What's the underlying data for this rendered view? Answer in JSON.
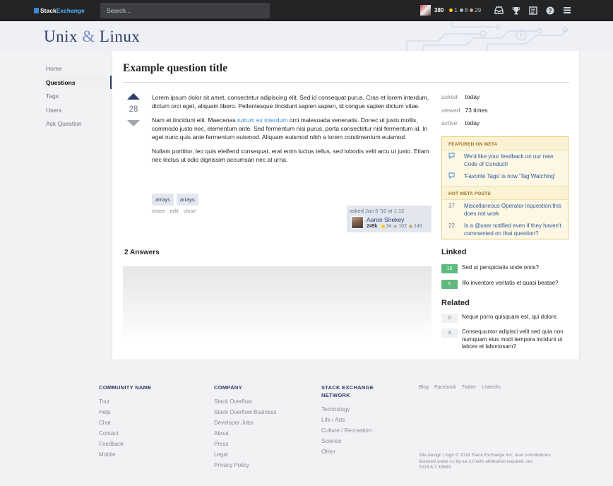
{
  "topbar": {
    "brand_first": "Stack",
    "brand_second": "Exchange",
    "search_placeholder": "Search...",
    "reputation": "380",
    "gold": "1",
    "silver": "8",
    "bronze": "29",
    "icons": [
      "inbox-icon",
      "trophy-icon",
      "review-icon",
      "help-icon",
      "site-switcher-icon"
    ]
  },
  "site": {
    "name_part1": "Unix",
    "amp": "&",
    "name_part2": "Linux"
  },
  "nav": {
    "items": [
      "Home",
      "Questions",
      "Tags",
      "Users",
      "Ask Question"
    ]
  },
  "question": {
    "title": "Example question title",
    "votes": "28",
    "p1": "Lorem ipsum dolor sit amet, consectetur adipiscing elit. Sed id consequat purus. Cras et lorem interdum, dictum orci eget, aliquam libero. Pellentesque tincidunt sapien sapien, id congue sapien dictum vitae.",
    "p2_before": "Nam et tincidunt elit. Maecenas ",
    "p2_link": "rutrum ex interdum",
    "p2_after": " orci malesuada venenatis. Donec ut justo mollis, commodo justo nec, elementum ante. Sed fermentum nisi purus, porta consectetur nisl fermentum id. In eget nunc quis ante fermentum euismod. Aliquam euismod nibh a lorem condimentum euismod.",
    "p3": "Nullam porttitor, leo quis eleifend consequat, erat enim luctus tellus, sed lobortis velit arcu ut justo. Etiam nec lectus ut odio dignissim accumsan nec at urna.",
    "tags": [
      "arrays",
      "arrays"
    ],
    "menu": [
      "share",
      "edit",
      "close"
    ],
    "owner": {
      "asked": "asked Jan 5 '10 at 1:12",
      "name": "Aaron Shekey",
      "rep": "249k",
      "gold": "34",
      "silver": "102",
      "bronze": "143"
    }
  },
  "answers": {
    "header": "2 Answers"
  },
  "meta": {
    "asked_label": "asked",
    "asked_value": "today",
    "viewed_label": "viewed",
    "viewed_value": "73 times",
    "active_label": "active",
    "active_value": "today"
  },
  "blog": {
    "featured_header": "FEATURED ON META",
    "featured": [
      "We'd like your feedback on our new Code of Conduct!",
      "'Favorite Tags' is now 'Tag Watching'"
    ],
    "hot_header": "HOT META POSTS",
    "hot": [
      {
        "num": "37",
        "text": "Miscellaneous Operator inquestion:this does not work"
      },
      {
        "num": "22",
        "text": "Is a @user notified even if they haven't commented on that question?"
      }
    ]
  },
  "linked": {
    "header": "Linked",
    "items": [
      {
        "score": "16",
        "text": "Sed ut perspiciatis unde omis?"
      },
      {
        "score": "5",
        "text": "Illo inventore veritatis et quasi beatae?"
      }
    ]
  },
  "related": {
    "header": "Related",
    "items": [
      {
        "score": "0",
        "text": "Neque porro quisquam est, qui dolore."
      },
      {
        "score": "4",
        "text": "Consequuntor adipisci velit sed quia non numquam eius modi tempora incidunt ut labore et laboriosam?"
      }
    ]
  },
  "footer": {
    "col1": {
      "head": "COMMUNITY NAME",
      "links": [
        "Tour",
        "Help",
        "Chat",
        "Contact",
        "Feedback",
        "Mobile"
      ]
    },
    "col2": {
      "head": "COMPANY",
      "links": [
        "Stack Overflow",
        "Stack Overflow Business",
        "Developer Jobs",
        "About",
        "Press",
        "Legal",
        "Privacy Policy"
      ]
    },
    "col3": {
      "head": "STACK EXCHANGE NETWORK",
      "links": [
        "Technology",
        "Life / Arts",
        "Culture / Recreation",
        "Science",
        "Other"
      ]
    },
    "social": [
      "Blog",
      "Facebook",
      "Twitter",
      "LinkedIn"
    ],
    "legal": "Site design / logo © 2018 Stack Exchange Inc; user contributions licensed under cc by-sa 3.0 with attribution required. rev 2018.6.7.30693"
  },
  "colors": {
    "topbar": "#222426",
    "accent": "#2d3b66",
    "link": "#3a8ad8",
    "accepted": "#5eba7d"
  }
}
